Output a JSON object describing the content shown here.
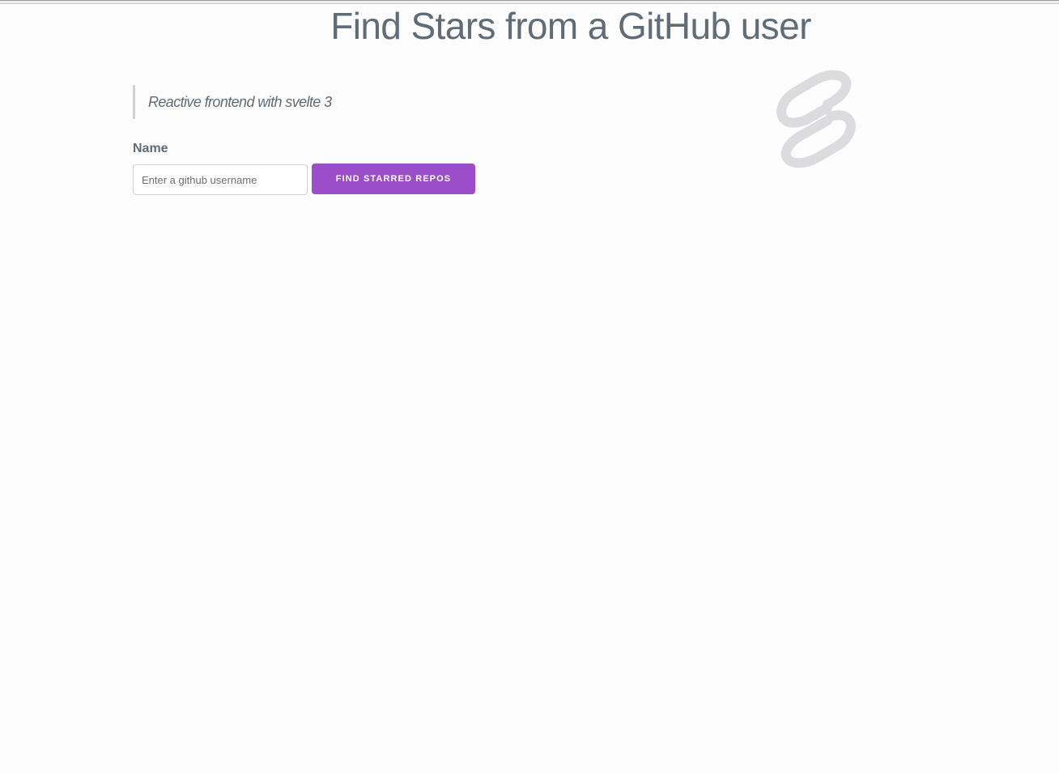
{
  "header": {
    "title": "Find Stars from a GitHub user"
  },
  "intro": {
    "quote": "Reactive frontend with svelte 3"
  },
  "search": {
    "label": "Name",
    "placeholder": "Enter a github username",
    "value": "",
    "button_label": "FIND STARRED REPOS"
  },
  "logo": {
    "icon": "svelte-logo-icon",
    "color": "#dcdcde"
  },
  "colors": {
    "accent": "#9b4dca",
    "text": "#606c76",
    "background": "#fdfdfd"
  }
}
